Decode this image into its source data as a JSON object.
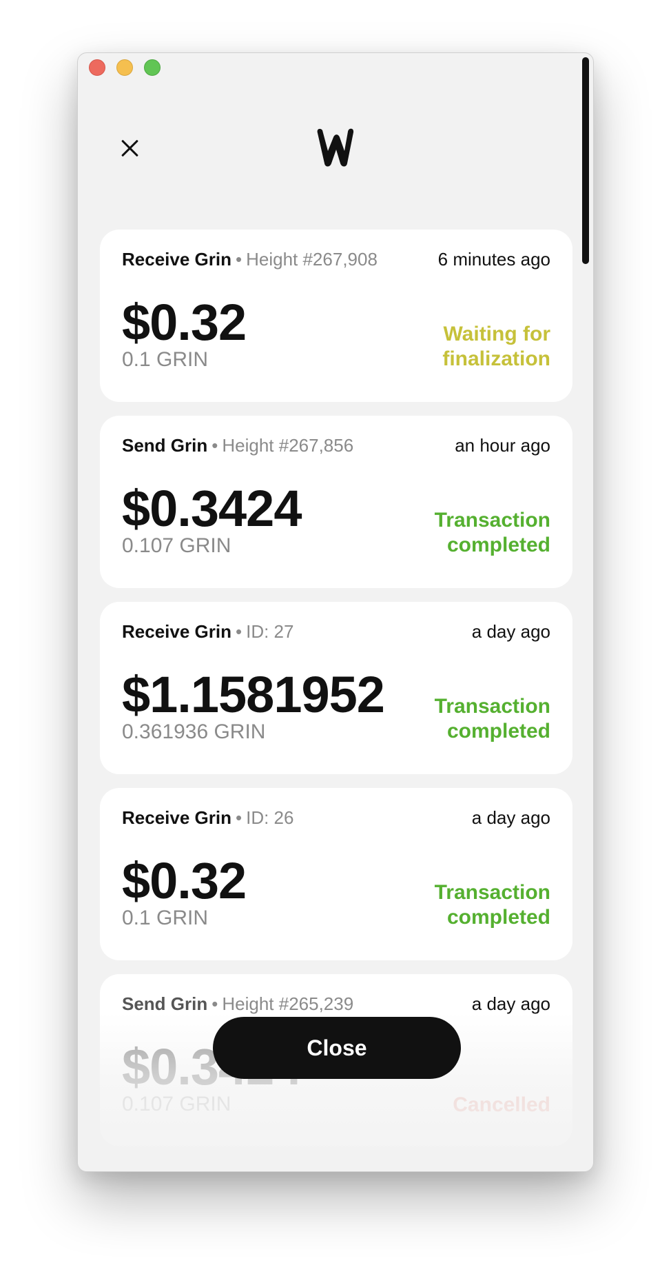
{
  "header": {
    "close_icon": "close-icon",
    "logo": "w-logo"
  },
  "transactions": [
    {
      "kind": "Receive Grin",
      "ref": "Height #267,908",
      "time": "6 minutes ago",
      "amount": "$0.32",
      "grin": "0.1 GRIN",
      "status_line1": "Waiting for",
      "status_line2": "finalization",
      "status_color": "#c6c13a"
    },
    {
      "kind": "Send Grin",
      "ref": "Height #267,856",
      "time": "an hour ago",
      "amount": "$0.3424",
      "grin": "0.107 GRIN",
      "status_line1": "Transaction",
      "status_line2": "completed",
      "status_color": "#55b030"
    },
    {
      "kind": "Receive Grin",
      "ref": "ID: 27",
      "time": "a day ago",
      "amount": "$1.1581952",
      "grin": "0.361936 GRIN",
      "status_line1": "Transaction",
      "status_line2": "completed",
      "status_color": "#55b030"
    },
    {
      "kind": "Receive Grin",
      "ref": "ID: 26",
      "time": "a day ago",
      "amount": "$0.32",
      "grin": "0.1 GRIN",
      "status_line1": "Transaction",
      "status_line2": "completed",
      "status_color": "#55b030"
    },
    {
      "kind": "Send Grin",
      "ref": "Height #265,239",
      "time": "a day ago",
      "amount": "$0.3424",
      "grin": "0.107 GRIN",
      "status_line1": "Cancelled",
      "status_color": "#f0b8b0"
    }
  ],
  "footer": {
    "close_label": "Close"
  },
  "colors": {
    "background": "#f2f2f2",
    "card": "#ffffff",
    "waiting": "#c6c13a",
    "completed": "#55b030",
    "cancelled": "#f0b8b0",
    "button": "#111111"
  }
}
